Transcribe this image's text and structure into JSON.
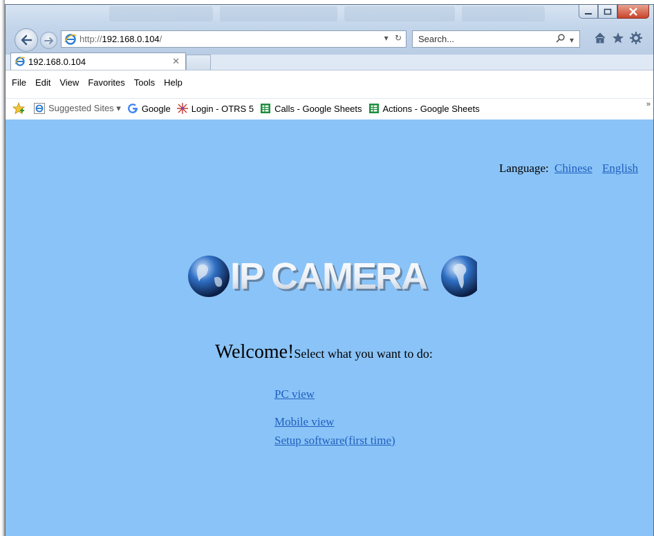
{
  "browser": {
    "url_prefix": "http://",
    "url_host": "192.168.0.104",
    "url_suffix": "/",
    "search_placeholder": "Search...",
    "tab_title": "192.168.0.104"
  },
  "menu": [
    "File",
    "Edit",
    "View",
    "Favorites",
    "Tools",
    "Help"
  ],
  "favorites": [
    {
      "label": "Suggested Sites ▾",
      "icon": "ie-icon"
    },
    {
      "label": "Google",
      "icon": "google-icon"
    },
    {
      "label": "Login - OTRS 5",
      "icon": "otrs-icon"
    },
    {
      "label": "Calls - Google Sheets",
      "icon": "sheets-icon"
    },
    {
      "label": "Actions - Google Sheets",
      "icon": "sheets-icon"
    }
  ],
  "page": {
    "language_label": "Language:",
    "lang_chinese": "Chinese",
    "lang_english": "English",
    "logo_text": "IP CAMERA",
    "welcome_big": "Welcome!",
    "welcome_small": "Select what you want to do:",
    "link_pc": "PC view",
    "link_mobile": "Mobile view",
    "link_setup": "Setup software(first time)"
  },
  "colors": {
    "page_bg": "#8ac3f7",
    "link": "#1f5fbf",
    "titlebar": "#c3d5ea"
  }
}
